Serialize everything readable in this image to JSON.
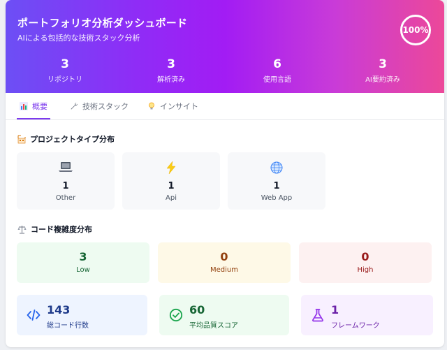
{
  "header": {
    "title": "ポートフォリオ分析ダッシュボード",
    "subtitle": "AIによる包括的な技術スタック分析",
    "completion_badge": "100%"
  },
  "stats": [
    {
      "value": "3",
      "label": "リポジトリ"
    },
    {
      "value": "3",
      "label": "解析済み"
    },
    {
      "value": "6",
      "label": "使用言語"
    },
    {
      "value": "3",
      "label": "AI要約済み"
    }
  ],
  "tabs": [
    {
      "label": "概要",
      "icon": "bar-chart-icon",
      "active": true
    },
    {
      "label": "技術スタック",
      "icon": "wrench-icon",
      "active": false
    },
    {
      "label": "インサイト",
      "icon": "lightbulb-icon",
      "active": false
    }
  ],
  "project_types": {
    "title": "プロジェクトタイプ分布",
    "items": [
      {
        "icon": "laptop-icon",
        "count": "1",
        "label": "Other"
      },
      {
        "icon": "lightning-icon",
        "count": "1",
        "label": "Api"
      },
      {
        "icon": "globe-icon",
        "count": "1",
        "label": "Web App"
      }
    ]
  },
  "complexity": {
    "title": "コード複雑度分布",
    "items": [
      {
        "count": "3",
        "label": "Low",
        "bg": "#eefbf1",
        "color": "#166534"
      },
      {
        "count": "0",
        "label": "Medium",
        "bg": "#fef9e7",
        "color": "#92400e"
      },
      {
        "count": "0",
        "label": "High",
        "bg": "#fdf1f1",
        "color": "#991b1b"
      }
    ]
  },
  "metrics": [
    {
      "value": "143",
      "label": "総コード行数",
      "icon": "code-icon",
      "bg": "#eef4ff",
      "color": "#1e3a8a"
    },
    {
      "value": "60",
      "label": "平均品質スコア",
      "icon": "check-circle-icon",
      "bg": "#eefbf1",
      "color": "#166534"
    },
    {
      "value": "1",
      "label": "フレームワーク",
      "icon": "flask-icon",
      "bg": "#f8f0ff",
      "color": "#6b21a8"
    }
  ],
  "colors": {
    "accent": "#7c3aed",
    "gradient_start": "#6c4ff5",
    "gradient_end": "#ec4899"
  }
}
